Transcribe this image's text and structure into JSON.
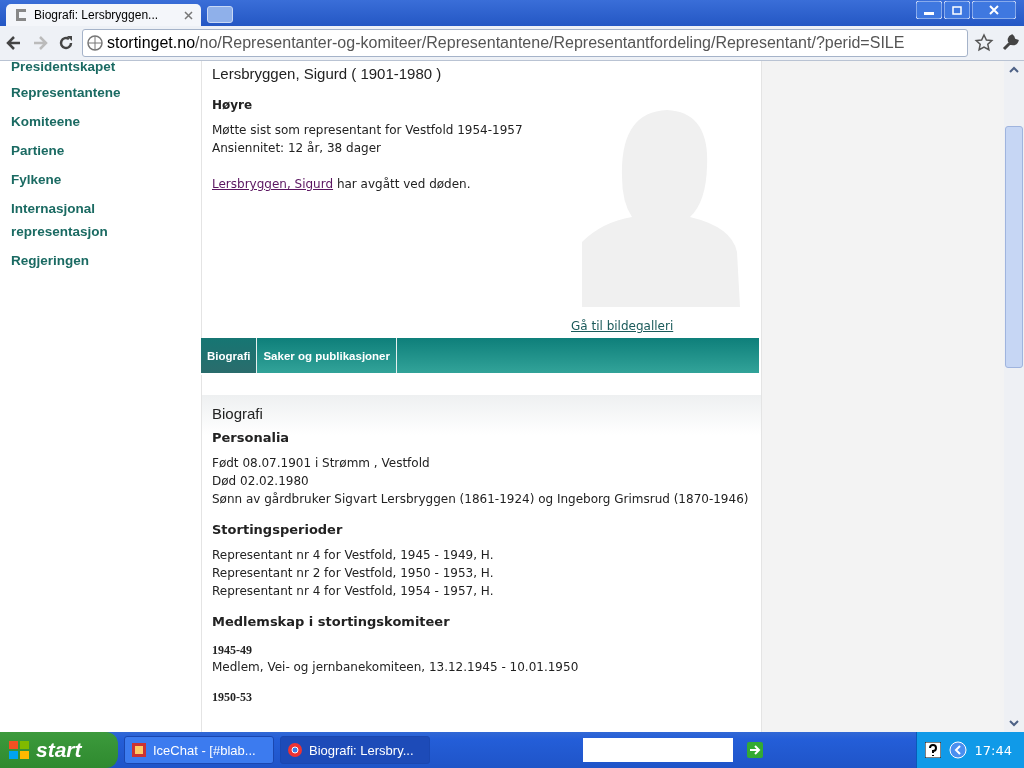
{
  "browser": {
    "tab_title": "Biografi: Lersbryggen...",
    "url_host": "stortinget.no",
    "url_path": "/no/Representanter-og-komiteer/Representantene/Representantfordeling/Representant/?perid=SILE"
  },
  "sidebar": {
    "items": [
      {
        "label": "Presidentskapet"
      },
      {
        "label": "Representantene"
      },
      {
        "label": "Komiteene"
      },
      {
        "label": "Partiene"
      },
      {
        "label": "Fylkene"
      },
      {
        "label": "Internasjonal representasjon"
      },
      {
        "label": "Regjeringen"
      }
    ]
  },
  "profile": {
    "name": "Lersbryggen, Sigurd ( 1901-1980 )",
    "party": "Høyre",
    "lines": [
      "Møtte sist som representant for Vestfold 1954-1957",
      "Ansiennitet: 12 år, 38 dager"
    ],
    "deceased_link": "Lersbryggen, Sigurd",
    "deceased_text": "har avgått ved døden.",
    "gallery_link": "Gå til bildegalleri"
  },
  "tabs": [
    {
      "label": "Biografi",
      "selected": true
    },
    {
      "label": "Saker og publikasjoner",
      "selected": false
    }
  ],
  "biography": {
    "title": "Biografi",
    "sections": [
      {
        "heading": "Personalia",
        "lines": [
          "Født 08.07.1901 i Strømm , Vestfold",
          "Død 02.02.1980",
          "Sønn av gårdbruker Sigvart Lersbryggen (1861-1924) og Ingeborg Grimsrud (1870-1946)"
        ]
      },
      {
        "heading": "Stortingsperioder",
        "lines": [
          "Representant nr 4 for Vestfold, 1945 - 1949, H.",
          "Representant nr 2 for Vestfold, 1950 - 1953, H.",
          "Representant nr 4 for Vestfold, 1954 - 1957, H."
        ]
      },
      {
        "heading": "Medlemskap i stortingskomiteer",
        "periods": [
          {
            "years": "1945-49",
            "text": "Medlem, Vei- og jernbanekomiteen, 13.12.1945 - 10.01.1950"
          },
          {
            "years": "1950-53"
          }
        ]
      }
    ]
  },
  "taskbar": {
    "start": "start",
    "tasks": [
      {
        "label": "IceChat - [#blab...",
        "selected": false
      },
      {
        "label": "Biografi: Lersbry...",
        "selected": true
      }
    ],
    "clock": "17:44"
  }
}
